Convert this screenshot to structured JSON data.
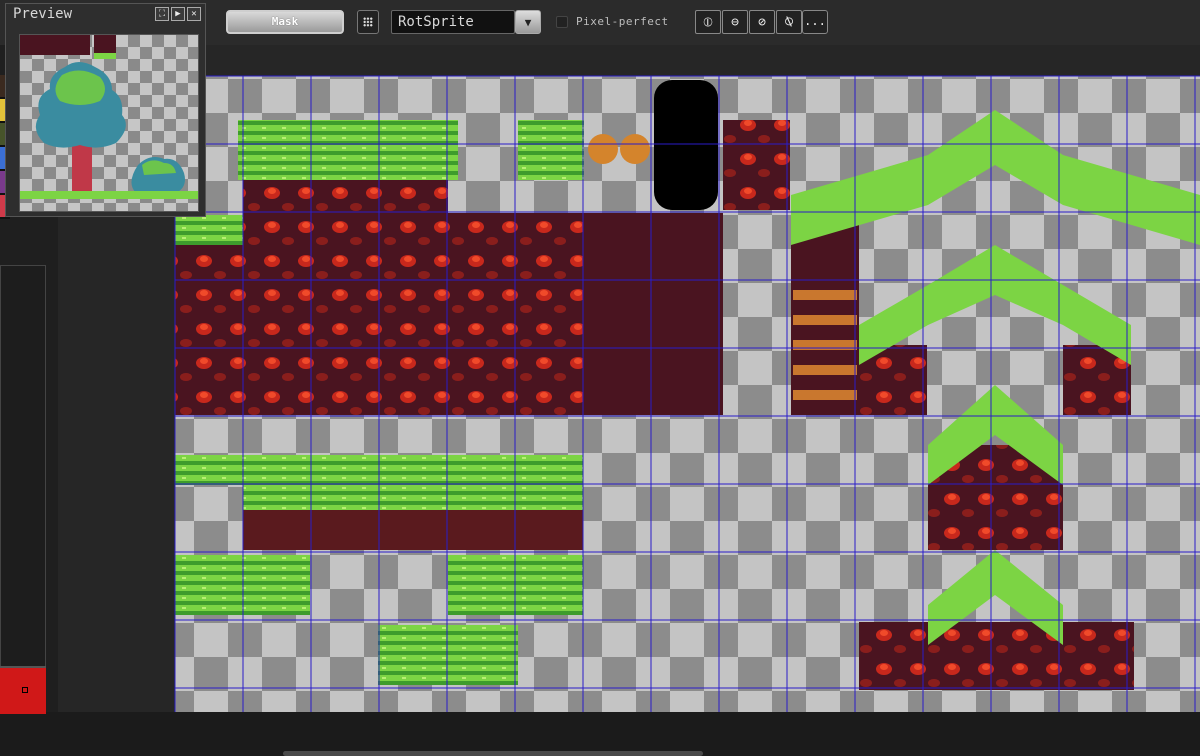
{
  "toolbar": {
    "mask_label": "Mask",
    "rotation_algorithm": "RotSprite",
    "pixel_perfect_label": "Pixel-perfect",
    "pixel_perfect_checked": false,
    "more_label": "..."
  },
  "preview": {
    "title": "Preview"
  },
  "colors": {
    "accent_fg": "#d01818",
    "grid": "#2a1dc8",
    "palette": [
      "#3b2a1f",
      "#e2c23a",
      "#47542a",
      "#3b6fd4",
      "#7a3a8c",
      "#d03a4a"
    ]
  },
  "icons": [
    "grid-toggle-icon",
    "dropdown-arrow-icon",
    "symmetry-vertical-icon",
    "symmetry-horizontal-icon",
    "symmetry-diagonal-icon",
    "symmetry-antidiagonal-icon",
    "expand-icon",
    "play-icon",
    "close-icon"
  ]
}
